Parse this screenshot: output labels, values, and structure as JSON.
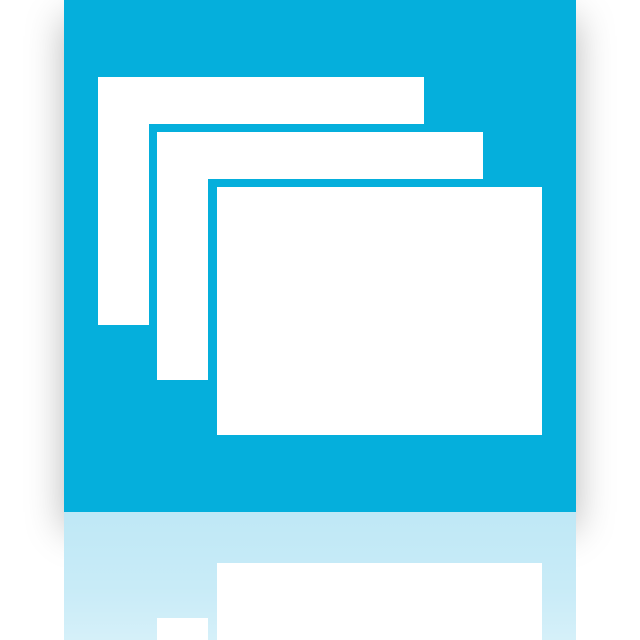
{
  "icon": {
    "name": "windows-stack-icon",
    "colors": {
      "tile": "#05afdc",
      "glyph": "#ffffff",
      "reflection_tile": "#bfe8f6"
    }
  }
}
